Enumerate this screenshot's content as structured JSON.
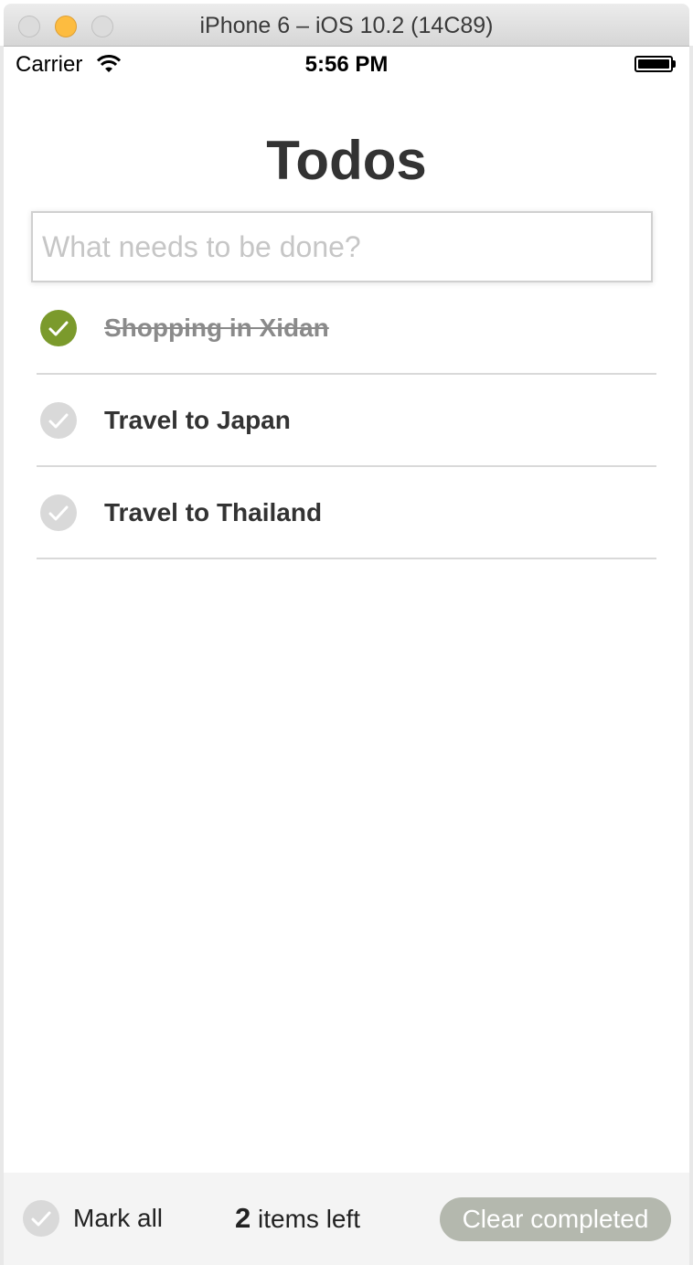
{
  "window": {
    "title": "iPhone 6 – iOS 10.2 (14C89)"
  },
  "statusbar": {
    "carrier": "Carrier",
    "time": "5:56 PM"
  },
  "app": {
    "title": "Todos",
    "new_todo_placeholder": "What needs to be done?",
    "new_todo_value": ""
  },
  "todos": [
    {
      "label": "Shopping in Xidan",
      "completed": true
    },
    {
      "label": "Travel to Japan",
      "completed": false
    },
    {
      "label": "Travel to Thailand",
      "completed": false
    }
  ],
  "footer": {
    "mark_all_label": "Mark all",
    "items_left_count": "2",
    "items_left_suffix": " items left",
    "clear_completed_label": "Clear completed"
  },
  "colors": {
    "completed_check": "#7b9a2c",
    "incomplete_check": "#d9d9d9",
    "clear_button": "#b4b8ae",
    "traffic_minimize": "#fdbc40"
  },
  "icons": {
    "wifi": "wifi-icon",
    "battery": "battery-icon",
    "check": "checkmark-icon"
  }
}
